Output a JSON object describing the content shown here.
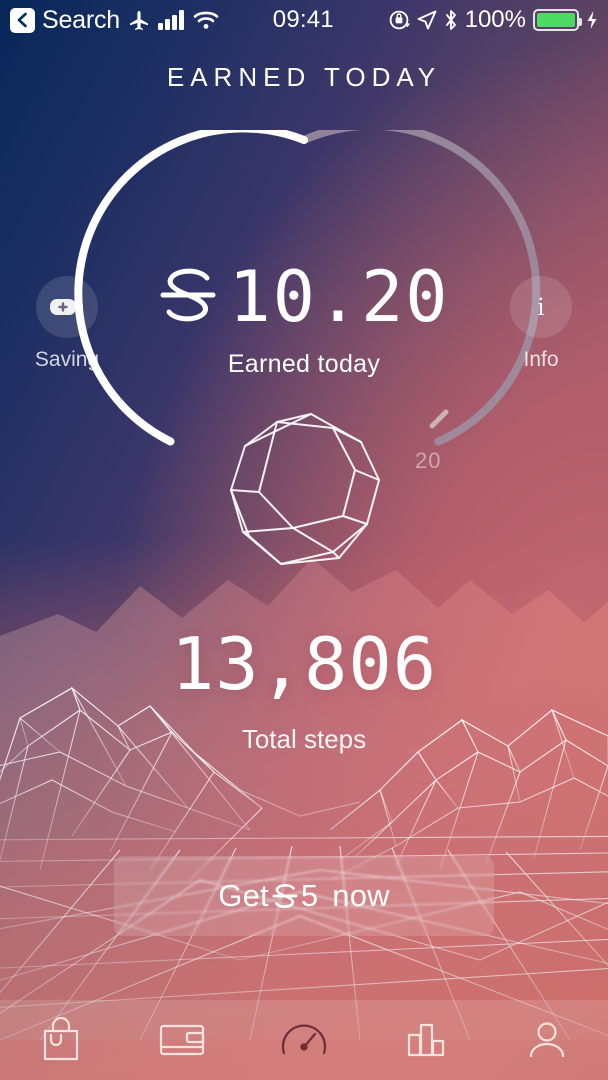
{
  "status_bar": {
    "back_label": "Search",
    "time": "09:41",
    "battery_percent": "100%",
    "icons": [
      "back-chevron-icon",
      "airplane-mode-icon",
      "cellular-signal-icon",
      "wifi-icon",
      "rotation-lock-icon",
      "location-arrow-icon",
      "bluetooth-icon",
      "battery-icon",
      "charging-bolt-icon"
    ]
  },
  "header": {
    "title": "EARNED TODAY"
  },
  "ring": {
    "max_label": "20",
    "progress_value": 10.2,
    "max_value": 20,
    "progress_color": "#ffffff",
    "track_color": "#9d8fa0"
  },
  "earned": {
    "currency_symbol": "sweatcoin-symbol",
    "amount": "10.20",
    "label": "Earned today"
  },
  "saving_button": {
    "label": "Saving",
    "icon": "battery-plus-icon"
  },
  "info_button": {
    "label": "Info",
    "icon": "info-icon",
    "glyph": "i"
  },
  "polyhedron": {
    "name": "dodecahedron-wireframe"
  },
  "steps": {
    "value": "13,806",
    "label": "Total steps"
  },
  "cta": {
    "prefix": "Get",
    "currency_symbol": "sweatcoin-symbol",
    "amount": "5",
    "suffix": "now",
    "full_label": "Get Ŝ5 now"
  },
  "tabbar": {
    "items": [
      {
        "name": "marketplace",
        "icon": "shopping-bag-icon",
        "active": false
      },
      {
        "name": "wallet",
        "icon": "wallet-icon",
        "active": false
      },
      {
        "name": "dashboard",
        "icon": "speedometer-icon",
        "active": true
      },
      {
        "name": "stats",
        "icon": "bar-chart-icon",
        "active": false
      },
      {
        "name": "profile",
        "icon": "person-icon",
        "active": false
      }
    ],
    "active_color": "#6e3038",
    "inactive_color": "#fbe3df"
  },
  "theme": {
    "bg_top_left": "#0a2a5e",
    "bg_top_right": "#594564",
    "bg_mid_right": "#b05e6e",
    "bg_bottom": "#e8786e",
    "text_primary": "#ffffff"
  }
}
